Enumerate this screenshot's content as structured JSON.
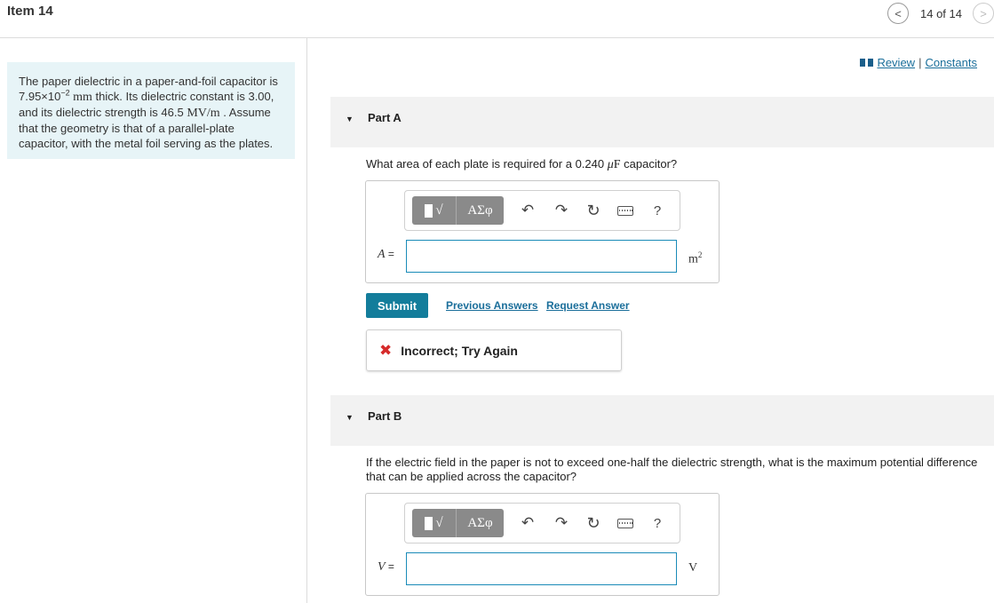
{
  "header": {
    "item_title": "Item 14",
    "nav_prev": "<",
    "nav_count": "14 of 14",
    "nav_next": ">"
  },
  "problem": {
    "line1": "The paper dielectric in a paper-and-foil capacitor is",
    "l2_a": "7.95×10",
    "l2_exp": "−2",
    "l2_unit": " mm",
    "l2_b": " thick. Its dielectric constant is 3.00,",
    "l3_a": "and its dielectric strength is 46.5 ",
    "l3_unit": "MV/m",
    "l3_b": " . Assume",
    "line4": "that the geometry is that of a parallel-plate",
    "line5": "capacitor, with the metal foil serving as the plates."
  },
  "resources": {
    "review": "Review",
    "separator": "|",
    "constants": "Constants"
  },
  "toolbar": {
    "templates_icon": "√",
    "symbols_label": "ΑΣφ",
    "undo_icon": "↶",
    "redo_icon": "↷",
    "reset_icon": "↻",
    "help_label": "?"
  },
  "part_a": {
    "caret": "▼",
    "label": "Part A",
    "q_a": "What area of each plate is required for a 0.240 ",
    "q_mu": "μ",
    "q_F": "F",
    "q_b": " capacitor?",
    "var": "A",
    "eq": " =",
    "input_value": "",
    "unit_base": "m",
    "unit_exp": "2",
    "submit_label": "Submit",
    "previous_answers": "Previous Answers",
    "request_answer": "Request Answer",
    "feedback_icon": "✖",
    "feedback_text": "Incorrect; Try Again"
  },
  "part_b": {
    "caret": "▼",
    "label": "Part B",
    "q_line1": "If the electric field in the paper is not to exceed one-half the dielectric strength, what is the maximum potential difference",
    "q_line2": "that can be applied across the capacitor?",
    "var": "V",
    "eq": " =",
    "input_value": "",
    "unit": "V"
  },
  "colors": {
    "accent": "#137d9b",
    "link": "#1a6e9a",
    "problem_bg": "#e7f4f7",
    "error": "#d62b2b"
  },
  "icons": {
    "review": "book-icon",
    "templates": "templates-icon",
    "keyboard": "keyboard-icon",
    "error": "x-mark-icon"
  }
}
